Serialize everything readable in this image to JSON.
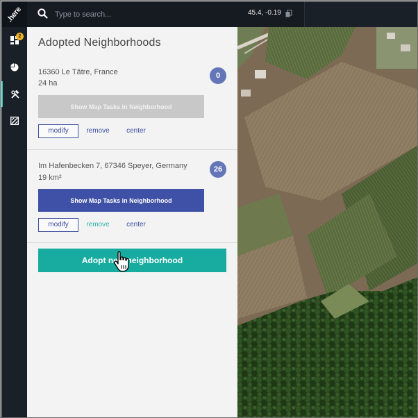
{
  "brand": {
    "logo_text": ".here"
  },
  "rail": {
    "items": [
      {
        "name": "dashboard",
        "icon": "dashboard-icon",
        "badge": "2"
      },
      {
        "name": "statistics",
        "icon": "pie-chart-icon"
      },
      {
        "name": "tools",
        "icon": "tools-icon",
        "active": true
      },
      {
        "name": "map-tasks",
        "icon": "map-tile-icon"
      }
    ]
  },
  "search": {
    "placeholder": "Type to search..."
  },
  "coords": {
    "text": "45.4, -0.19"
  },
  "panel": {
    "title": "Adopted Neighborhoods",
    "neighborhoods": [
      {
        "address": "16360 Le Tâtre, France",
        "area": "24 ha",
        "task_count": "0",
        "show_label": "Show Map Tasks in Neighborhood",
        "show_enabled": false,
        "modify_label": "modify",
        "remove_label": "remove",
        "center_label": "center"
      },
      {
        "address": "Im Hafenbecken 7, 67346 Speyer, Germany",
        "area": "19 km²",
        "task_count": "26",
        "show_label": "Show Map Tasks in Neighborhood",
        "show_enabled": true,
        "modify_label": "modify",
        "remove_label": "remove",
        "center_label": "center"
      }
    ],
    "adopt_label": "Adopt new neighborhood"
  },
  "colors": {
    "rail_bg": "#1a2028",
    "topbar_bg": "#161b22",
    "accent_teal": "#18aca0",
    "primary_blue": "#3f51a6",
    "badge_blue": "#6476b8",
    "badge_yellow": "#f0b324"
  }
}
